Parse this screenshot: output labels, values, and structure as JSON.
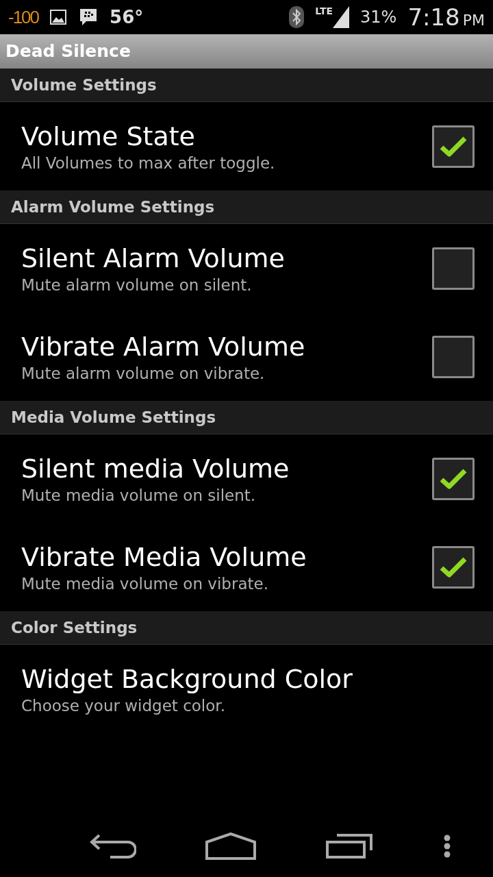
{
  "status_bar": {
    "badge": "-100",
    "temperature": "56°",
    "network": "LTE",
    "battery": "31%",
    "time": "7:18",
    "meridiem": "PM"
  },
  "title": "Dead Silence",
  "sections": [
    {
      "header": "Volume Settings",
      "items": [
        {
          "kind": "checkbox",
          "title": "Volume State",
          "summary": "All Volumes to max after toggle.",
          "checked": true
        }
      ]
    },
    {
      "header": "Alarm Volume Settings",
      "items": [
        {
          "kind": "checkbox",
          "title": "Silent Alarm Volume",
          "summary": "Mute alarm volume on silent.",
          "checked": false
        },
        {
          "kind": "checkbox",
          "title": "Vibrate Alarm Volume",
          "summary": "Mute alarm volume on vibrate.",
          "checked": false
        }
      ]
    },
    {
      "header": "Media Volume Settings",
      "items": [
        {
          "kind": "checkbox",
          "title": "Silent media Volume",
          "summary": "Mute media volume on silent.",
          "checked": true
        },
        {
          "kind": "checkbox",
          "title": "Vibrate Media Volume",
          "summary": "Mute media volume on vibrate.",
          "checked": true
        }
      ]
    },
    {
      "header": "Color Settings",
      "items": [
        {
          "kind": "plain",
          "title": "Widget Background Color",
          "summary": "Choose your widget color."
        }
      ]
    }
  ]
}
